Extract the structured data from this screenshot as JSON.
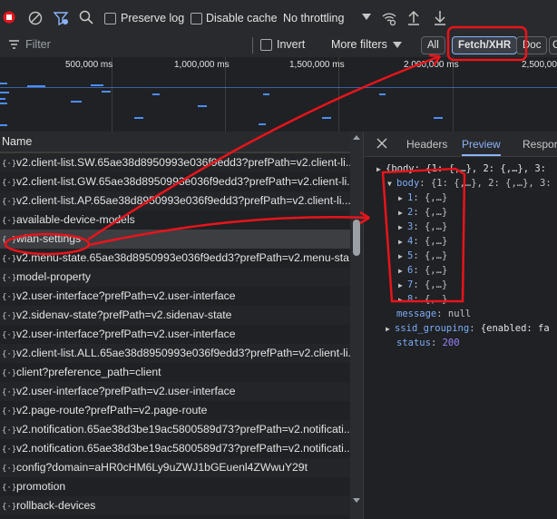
{
  "toolbar": {
    "preserve_log_label": "Preserve log",
    "disable_cache_label": "Disable cache",
    "throttling_value": "No throttling"
  },
  "filterbar": {
    "filter_placeholder": "Filter",
    "invert_label": "Invert",
    "more_filters_label": "More filters",
    "chips": [
      "All",
      "Fetch/XHR",
      "Doc",
      "C"
    ]
  },
  "timeline": {
    "ticks": [
      "500,000 ms",
      "1,000,000 ms",
      "1,500,000 ms",
      "2,000,000 ms",
      "2,500,000"
    ]
  },
  "list": {
    "header": "Name",
    "items": [
      "v2.client-list.SW.65ae38d8950993e036f9edd3?prefPath=v2.client-li...",
      "v2.client-list.GW.65ae38d8950993e036f9edd3?prefPath=v2.client-li...",
      "v2.client-list.AP.65ae38d8950993e036f9edd3?prefPath=v2.client-li...",
      "available-device-models",
      "wlan-settings",
      "v2.menu-state.65ae38d8950993e036f9edd3?prefPath=v2.menu-sta...",
      "model-property",
      "v2.user-interface?prefPath=v2.user-interface",
      "v2.sidenav-state?prefPath=v2.sidenav-state",
      "v2.user-interface?prefPath=v2.user-interface",
      "v2.client-list.ALL.65ae38d8950993e036f9edd3?prefPath=v2.client-li...",
      "client?preference_path=client",
      "v2.user-interface?prefPath=v2.user-interface",
      "v2.page-route?prefPath=v2.page-route",
      "v2.notification.65ae38d3be19ac5800589d73?prefPath=v2.notificati...",
      "v2.notification.65ae38d3be19ac5800589d73?prefPath=v2.notificati...",
      "config?domain=aHR0cHM6Ly9uZWJ1bGEuenl4ZWwuY29t",
      "promotion",
      "rollback-devices"
    ],
    "selected_index": 4
  },
  "detail": {
    "tabs": [
      "Headers",
      "Preview",
      "Respor"
    ],
    "active_tab": "Preview",
    "root_line": "{body: {1: {,…}, 2: {,…}, 3:",
    "body_line_key": "body",
    "body_line_val": "{1: {,…}, 2: {,…}, 3:",
    "entries": [
      "1",
      "2",
      "3",
      "4",
      "5",
      "6",
      "7",
      "8"
    ],
    "entry_value": "{,…}",
    "message_key": "message",
    "message_val": "null",
    "ssid_key": "ssid_grouping",
    "ssid_val": "{enabled: fa",
    "status_key": "status",
    "status_val": "200"
  },
  "colors": {
    "annotation": "#e8141b",
    "accent": "#8ab4f8",
    "record": "#e8141b"
  },
  "icons": [
    "record-stop-icon",
    "clear-icon",
    "filter-settings-icon",
    "search-icon",
    "wifi-settings-icon",
    "upload-icon",
    "download-icon",
    "filter-icon",
    "close-icon",
    "json-icon"
  ]
}
